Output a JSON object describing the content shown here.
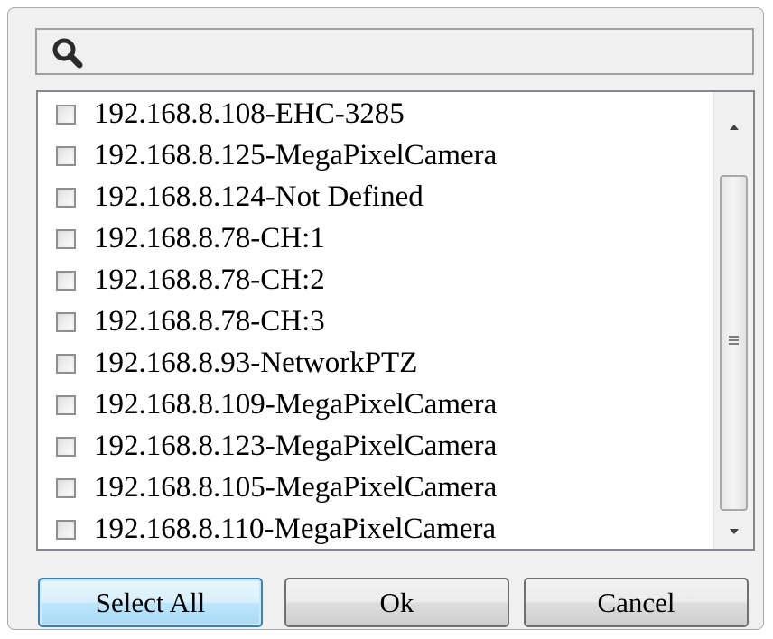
{
  "search": {
    "value": "",
    "placeholder": ""
  },
  "device_list": {
    "items": [
      {
        "label": "192.168.8.108-EHC-3285",
        "checked": false
      },
      {
        "label": "192.168.8.125-MegaPixelCamera",
        "checked": false
      },
      {
        "label": "192.168.8.124-Not Defined",
        "checked": false
      },
      {
        "label": "192.168.8.78-CH:1",
        "checked": false
      },
      {
        "label": "192.168.8.78-CH:2",
        "checked": false
      },
      {
        "label": "192.168.8.78-CH:3",
        "checked": false
      },
      {
        "label": "192.168.8.93-NetworkPTZ",
        "checked": false
      },
      {
        "label": "192.168.8.109-MegaPixelCamera",
        "checked": false
      },
      {
        "label": "192.168.8.123-MegaPixelCamera",
        "checked": false
      },
      {
        "label": "192.168.8.105-MegaPixelCamera",
        "checked": false
      },
      {
        "label": "192.168.8.110-MegaPixelCamera",
        "checked": false
      }
    ]
  },
  "buttons": {
    "select_all": "Select All",
    "ok": "Ok",
    "cancel": "Cancel"
  },
  "colors": {
    "default_button_border": "#3c7fb1",
    "dialog_background": "#f0f0f0"
  },
  "icons": {
    "search": "search-icon",
    "scroll_up": "chevron-up-icon",
    "scroll_down": "chevron-down-icon",
    "grip": "grip-icon"
  }
}
